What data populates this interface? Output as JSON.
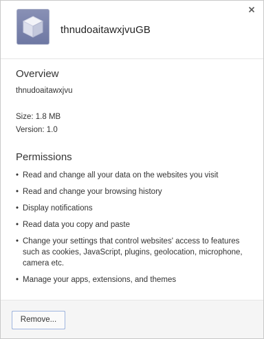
{
  "extension": {
    "name": "thnudoaitawxjvuGB",
    "icon": "cube-icon",
    "icon_color": "#7a83ac"
  },
  "overview": {
    "title": "Overview",
    "description": "thnudoaitawxjvu",
    "size": "Size: 1.8 MB",
    "version": "Version: 1.0"
  },
  "permissions": {
    "title": "Permissions",
    "items": [
      {
        "label": "Read and change all your data on the websites you visit"
      },
      {
        "label": "Read and change your browsing history"
      },
      {
        "label": "Display notifications"
      },
      {
        "label": "Read data you copy and paste"
      },
      {
        "label": "Change your settings that control websites' access to features such as cookies, JavaScript, plugins, geolocation, microphone, camera etc."
      },
      {
        "label": "Manage your apps, extensions, and themes"
      }
    ]
  },
  "footer": {
    "remove_label": "Remove..."
  },
  "close_icon": "close-icon"
}
